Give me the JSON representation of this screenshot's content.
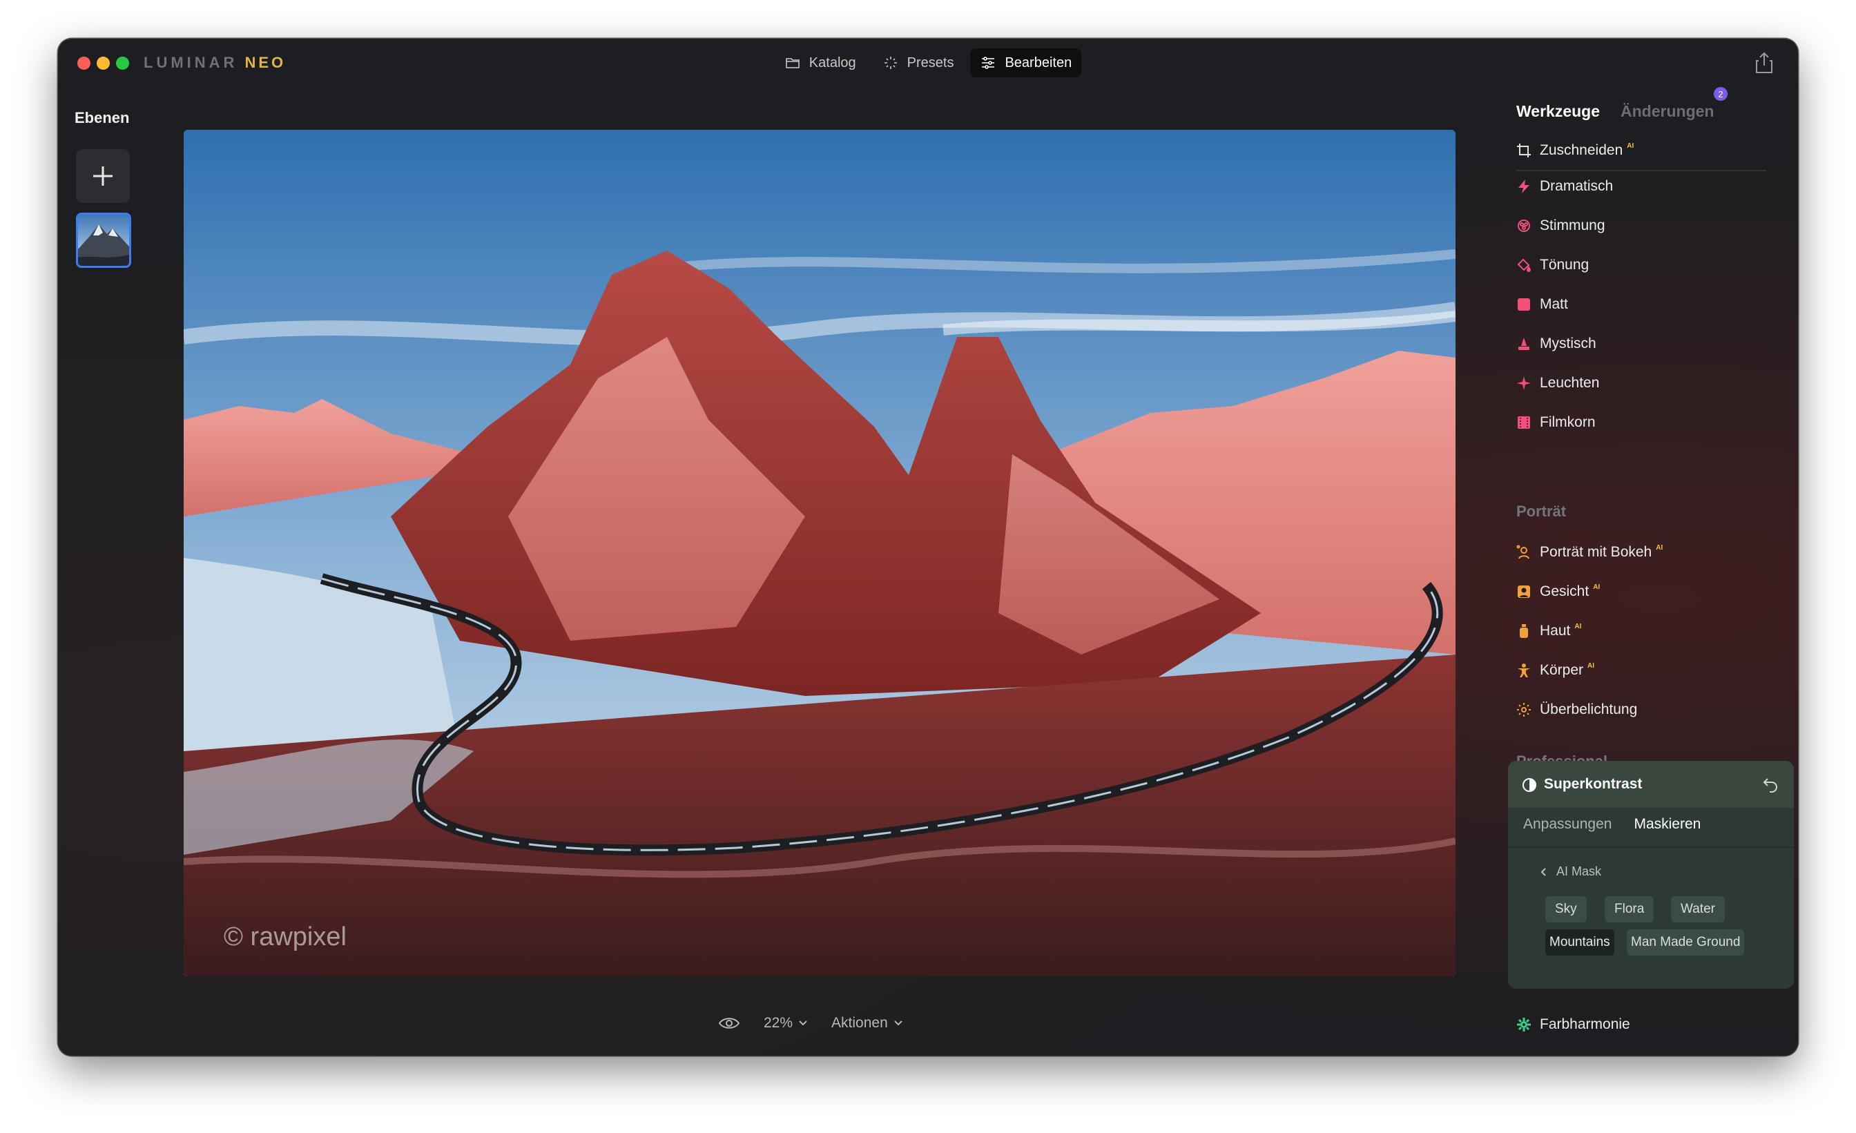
{
  "app": {
    "logo": "LUMINAR",
    "logo_accent": "NEO"
  },
  "nav": {
    "katalog": "Katalog",
    "presets": "Presets",
    "bearbeiten": "Bearbeiten"
  },
  "layers": {
    "title": "Ebenen"
  },
  "canvas": {
    "watermark": "© rawpixel"
  },
  "bottom": {
    "zoom": "22%",
    "aktionen": "Aktionen"
  },
  "panel": {
    "tabs": [
      "Werkzeuge",
      "Änderungen"
    ],
    "badge": "2",
    "crop": {
      "label": "Zuschneiden",
      "ai": "AI"
    },
    "creative": [
      "Dramatisch",
      "Stimmung",
      "Tönung",
      "Matt",
      "Mystisch",
      "Leuchten",
      "Filmkorn"
    ],
    "portrait_title": "Porträt",
    "portrait": [
      {
        "label": "Porträt mit Bokeh",
        "ai": "AI"
      },
      {
        "label": "Gesicht",
        "ai": "AI"
      },
      {
        "label": "Haut",
        "ai": "AI"
      },
      {
        "label": "Körper",
        "ai": "AI"
      },
      {
        "label": "Überbelichtung",
        "ai": ""
      }
    ],
    "professional_title": "Professional",
    "superkontrast": {
      "title": "Superkontrast",
      "tabs": [
        "Anpassungen",
        "Maskieren"
      ],
      "aimask": "AI Mask",
      "chips": [
        "Sky",
        "Flora",
        "Water",
        "Mountains",
        "Man Made Ground"
      ]
    },
    "farbharmonie": "Farbharmonie"
  },
  "colors": {
    "accent_tab": "#ffffff",
    "badge": "#7c5cf0",
    "panel_green": "#2d3a34",
    "selection": "#3d7cf5"
  }
}
